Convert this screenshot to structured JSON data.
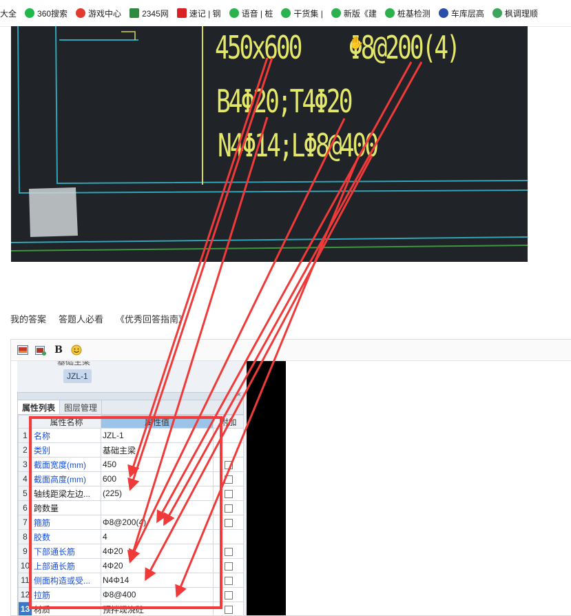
{
  "bookmarks": [
    {
      "label": "大全",
      "icon": "none",
      "color": "#ffffff"
    },
    {
      "label": "360搜索",
      "icon": "search-360-icon",
      "color": "#1fb84a"
    },
    {
      "label": "游戏中心",
      "icon": "game-center-icon",
      "color": "#e23b2e"
    },
    {
      "label": "2345网",
      "icon": "site-2345-icon",
      "color": "#2d8a3e"
    },
    {
      "label": "速记 | 钢",
      "icon": "ck-icon",
      "color": "#d92121"
    },
    {
      "label": "语音 | 桩",
      "icon": "wechat-icon",
      "color": "#2bb24c"
    },
    {
      "label": "干货集 |",
      "icon": "wechat-icon",
      "color": "#2bb24c"
    },
    {
      "label": "新版《建",
      "icon": "wechat-icon",
      "color": "#2bb24c"
    },
    {
      "label": "桩基检测",
      "icon": "wechat-icon",
      "color": "#2bb24c"
    },
    {
      "label": "车库层高",
      "icon": "share-icon",
      "color": "#2a4fa8"
    },
    {
      "label": "枫调理顺",
      "icon": "shield-icon",
      "color": "#3ba55c"
    }
  ],
  "cad": {
    "section": "450x600",
    "stirrup": "Φ8@200(4)",
    "long_bars": "B4Φ20;T4Φ20",
    "side_bars": "N4Φ14;LΦ8@400"
  },
  "answer_tabs": [
    "我的答案",
    "答题人必看",
    "《优秀回答指南》"
  ],
  "editor": {
    "toolbar": [
      "image-icon",
      "insert-image-icon",
      "bold-icon",
      "emoji-icon"
    ],
    "bold_label": "B"
  },
  "software": {
    "tree_node_label": "基础主梁",
    "selected_item": "JZL-1",
    "panel_close": "×",
    "tabs": [
      "属性列表",
      "图层管理"
    ],
    "columns": {
      "name": "属性名称",
      "value": "属性值",
      "extra": "附加"
    },
    "rows": [
      {
        "num": "1",
        "name": "名称",
        "value": "JZL-1",
        "blue": true,
        "check": false
      },
      {
        "num": "2",
        "name": "类别",
        "value": "基础主梁",
        "blue": true,
        "check": false
      },
      {
        "num": "3",
        "name": "截面宽度(mm)",
        "value": "450",
        "blue": true,
        "check": true
      },
      {
        "num": "4",
        "name": "截面高度(mm)",
        "value": "600",
        "blue": true,
        "check": true
      },
      {
        "num": "5",
        "name": "轴线距梁左边...",
        "value": "(225)",
        "blue": false,
        "check": true
      },
      {
        "num": "6",
        "name": "跨数量",
        "value": "",
        "blue": false,
        "check": true
      },
      {
        "num": "7",
        "name": "箍筋",
        "value": "Φ8@200(4)",
        "blue": true,
        "check": true
      },
      {
        "num": "8",
        "name": "胶数",
        "value": "4",
        "blue": true,
        "check": false
      },
      {
        "num": "9",
        "name": "下部通长筋",
        "value": "4Φ20",
        "blue": true,
        "check": true
      },
      {
        "num": "10",
        "name": "上部通长筋",
        "value": "4Φ20",
        "blue": true,
        "check": true
      },
      {
        "num": "11",
        "name": "侧面构造或受...",
        "value": "N4Φ14",
        "blue": true,
        "check": true
      },
      {
        "num": "12",
        "name": "拉筋",
        "value": "Φ8@400",
        "blue": true,
        "check": true
      },
      {
        "num": "13",
        "name": "材质",
        "value": "预拌现浇砼",
        "blue": false,
        "check": true
      }
    ]
  },
  "colors": {
    "cad_text": "#e4e86a",
    "arrow": "#f03a3a",
    "highlight_box": "#f23b3b",
    "selected_row": "#3a78c2"
  }
}
